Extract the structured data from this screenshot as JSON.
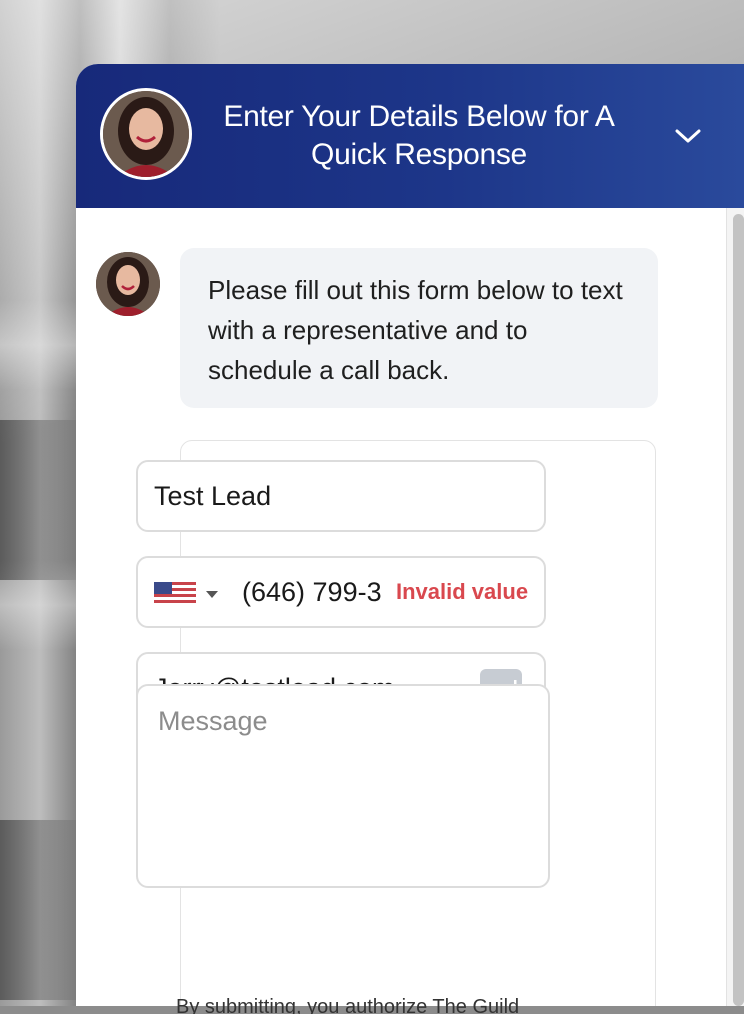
{
  "header": {
    "title": "Enter Your Details Below for A Quick Response",
    "collapse_icon": "chevron-down-icon"
  },
  "chat": {
    "message": "Please fill out this form below to text with a representative and to schedule a call back."
  },
  "form": {
    "name_value": "Test Lead",
    "phone_country": "US",
    "phone_value": "(646) 799-3",
    "phone_error": "Invalid value",
    "email_value": "Jerry@testlead.com",
    "message_placeholder": "Message",
    "disclaimer": "By submitting, you authorize The Guild"
  },
  "colors": {
    "header_start": "#17297a",
    "header_end": "#2a4a9c",
    "error": "#d9484e",
    "bubble_bg": "#f1f3f6"
  }
}
